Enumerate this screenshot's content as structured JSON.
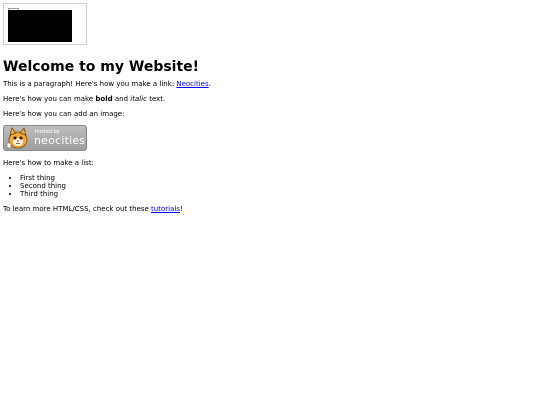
{
  "heading": "Welcome to my Website!",
  "paragraph1": {
    "before": "This is a paragraph! Here's how you make a link: ",
    "link": "Neocities",
    "after": "."
  },
  "paragraph2": {
    "before": "Here's how you can make ",
    "bold": "bold",
    "middle": " and ",
    "italic": "italic",
    "after": " text."
  },
  "paragraph3": "Here's how you can add an image:",
  "badge": {
    "small_text": "hosted by",
    "big_text": "neocities"
  },
  "list_intro": "Here's how to make a list:",
  "list_items": [
    "First thing",
    "Second thing",
    "Third thing"
  ],
  "paragraph5": {
    "before": "To learn more HTML/CSS, check out these ",
    "link": "tutorials",
    "after": "!"
  }
}
